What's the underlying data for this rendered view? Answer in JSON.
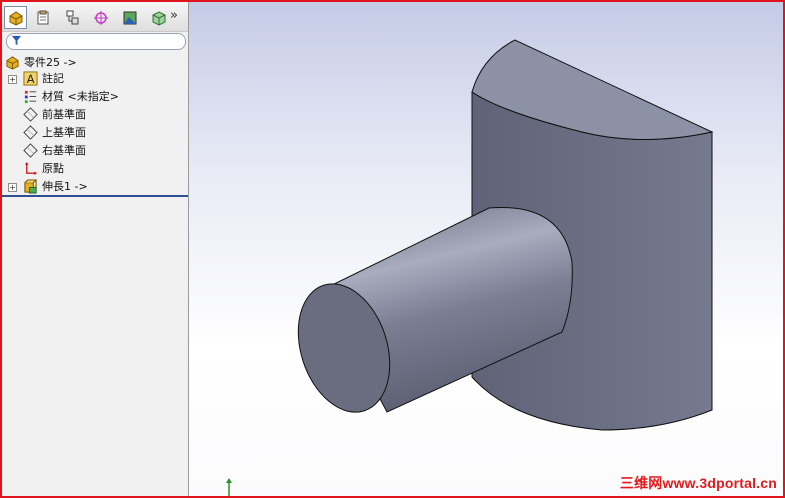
{
  "toolbar": {
    "buttons": [
      {
        "name": "feature-manager-tab-icon",
        "color": "#d7a020"
      },
      {
        "name": "property-manager-tab-icon",
        "color": "#b89a43"
      },
      {
        "name": "configuration-manager-tab-icon",
        "color": "#6f6f6f"
      },
      {
        "name": "dimxpert-manager-tab-icon",
        "color": "#c23fc2"
      },
      {
        "name": "display-manager-tab-icon",
        "color": "#3f8c3f"
      },
      {
        "name": "appearance-tab-icon",
        "color": "#4a9a4a"
      }
    ],
    "more_label": "»"
  },
  "feature_tree": {
    "root": {
      "label": "零件25 ->",
      "icon": "part-icon"
    },
    "items": [
      {
        "label": "註記",
        "icon": "annotations-icon",
        "expandable": true
      },
      {
        "label": "材質 <未指定>",
        "icon": "material-icon",
        "expandable": false
      },
      {
        "label": "前基準面",
        "icon": "plane-icon",
        "expandable": false
      },
      {
        "label": "上基準面",
        "icon": "plane-icon",
        "expandable": false
      },
      {
        "label": "右基準面",
        "icon": "plane-icon",
        "expandable": false
      },
      {
        "label": "原點",
        "icon": "origin-icon",
        "expandable": false
      },
      {
        "label": "伸長1 ->",
        "icon": "extrude-icon",
        "expandable": true
      }
    ]
  },
  "colors": {
    "frame": "#e0141e",
    "model_face": "#6e7285",
    "model_top": "#8e92a6",
    "watermark": "#e11b1b"
  },
  "watermark": "三维网www.3dportal.cn"
}
